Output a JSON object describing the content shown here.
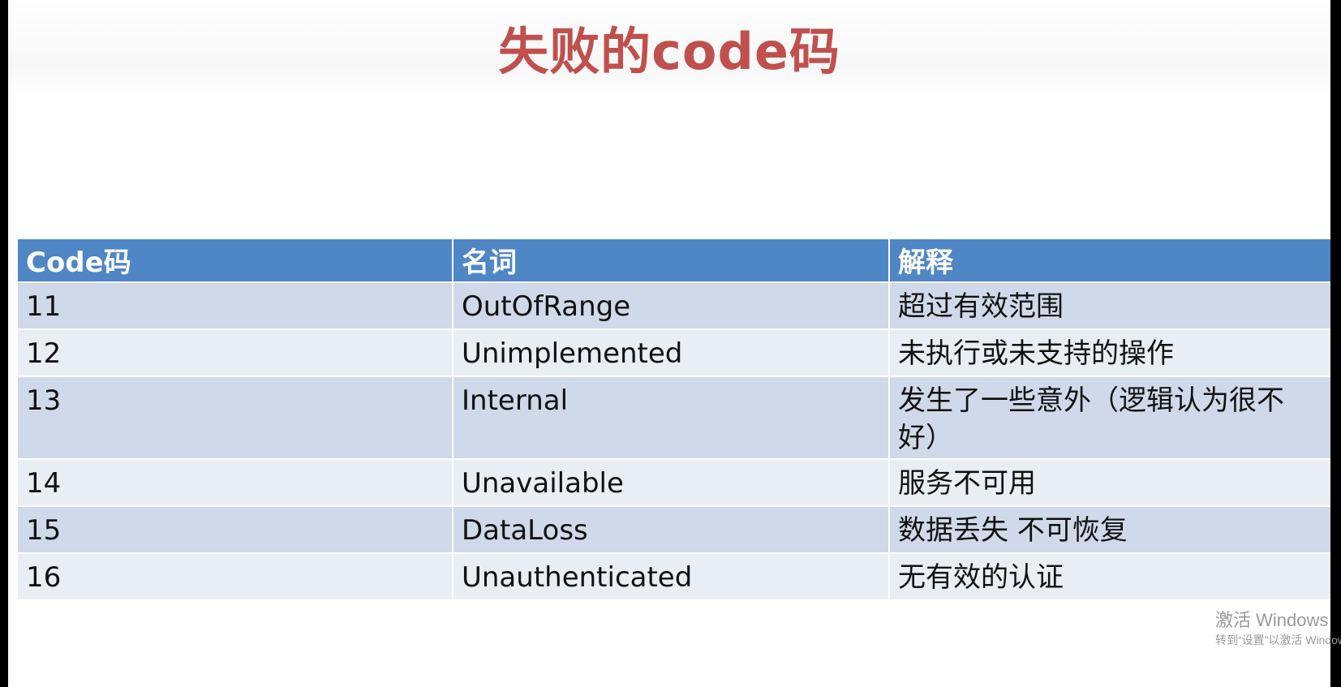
{
  "title": "失败的code码",
  "table": {
    "headers": [
      "Code码",
      "名词",
      "解释"
    ],
    "rows": [
      {
        "code": "11",
        "name": "OutOfRange",
        "desc": "超过有效范围"
      },
      {
        "code": "12",
        "name": "Unimplemented",
        "desc": "未执行或未支持的操作"
      },
      {
        "code": "13",
        "name": "Internal",
        "desc": "发生了一些意外（逻辑认为很不好）"
      },
      {
        "code": "14",
        "name": "Unavailable",
        "desc": "服务不可用"
      },
      {
        "code": "15",
        "name": "DataLoss",
        "desc": "数据丢失 不可恢复"
      },
      {
        "code": "16",
        "name": "Unauthenticated",
        "desc": "无有效的认证"
      }
    ]
  },
  "watermark": {
    "line1": "激活 Windows",
    "line2": "转到“设置”以激活 Windows。"
  },
  "colors": {
    "title": "#c0504d",
    "header_bg": "#4f86c6",
    "row_odd": "#d0d9ea",
    "row_even": "#e9edf4"
  }
}
